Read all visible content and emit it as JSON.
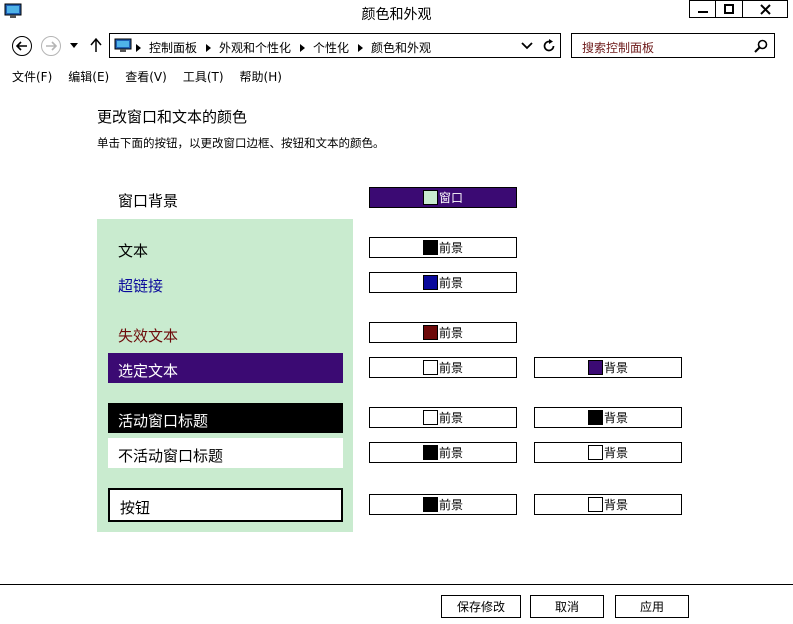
{
  "window": {
    "title": "颜色和外观"
  },
  "address_bar": {
    "breadcrumbs": [
      "控制面板",
      "外观和个性化",
      "个性化",
      "颜色和外观"
    ]
  },
  "search": {
    "placeholder": "搜索控制面板"
  },
  "menu": {
    "items": [
      "文件(F)",
      "编辑(E)",
      "查看(V)",
      "工具(T)",
      "帮助(H)"
    ]
  },
  "content": {
    "title": "更改窗口和文本的颜色",
    "description": "单击下面的按钮，以更改窗口边框、按钮和文本的颜色。"
  },
  "rows": {
    "window_bg": {
      "label": "窗口背景",
      "button": "窗口",
      "swatch": "#c9ebcf"
    },
    "text": {
      "label": "文本",
      "fg_label": "前景",
      "fg_swatch": "#000000"
    },
    "hyperlink": {
      "label": "超链接",
      "fg_label": "前景",
      "fg_swatch": "#0a0a9c"
    },
    "disabled_text": {
      "label": "失效文本",
      "fg_label": "前景",
      "fg_swatch": "#6d0a0a"
    },
    "selected_text": {
      "label": "选定文本",
      "fg_label": "前景",
      "fg_swatch": "#ffffff",
      "bg_label": "背景",
      "bg_swatch": "#3b0a73"
    },
    "active_title": {
      "label": "活动窗口标题",
      "fg_label": "前景",
      "fg_swatch": "#ffffff",
      "bg_label": "背景",
      "bg_swatch": "#000000"
    },
    "inactive_title": {
      "label": "不活动窗口标题",
      "fg_label": "前景",
      "fg_swatch": "#000000",
      "bg_label": "背景",
      "bg_swatch": "#ffffff"
    },
    "button": {
      "label": "按钮",
      "fg_label": "前景",
      "fg_swatch": "#000000",
      "bg_label": "背景",
      "bg_swatch": "#ffffff"
    }
  },
  "colors": {
    "panel_bg": "#c9ebcf",
    "hyperlink": "#0a0a9c",
    "disabled": "#6d0a0a",
    "selected_bg": "#3b0a73"
  },
  "footer": {
    "save": "保存修改",
    "cancel": "取消",
    "apply": "应用"
  }
}
